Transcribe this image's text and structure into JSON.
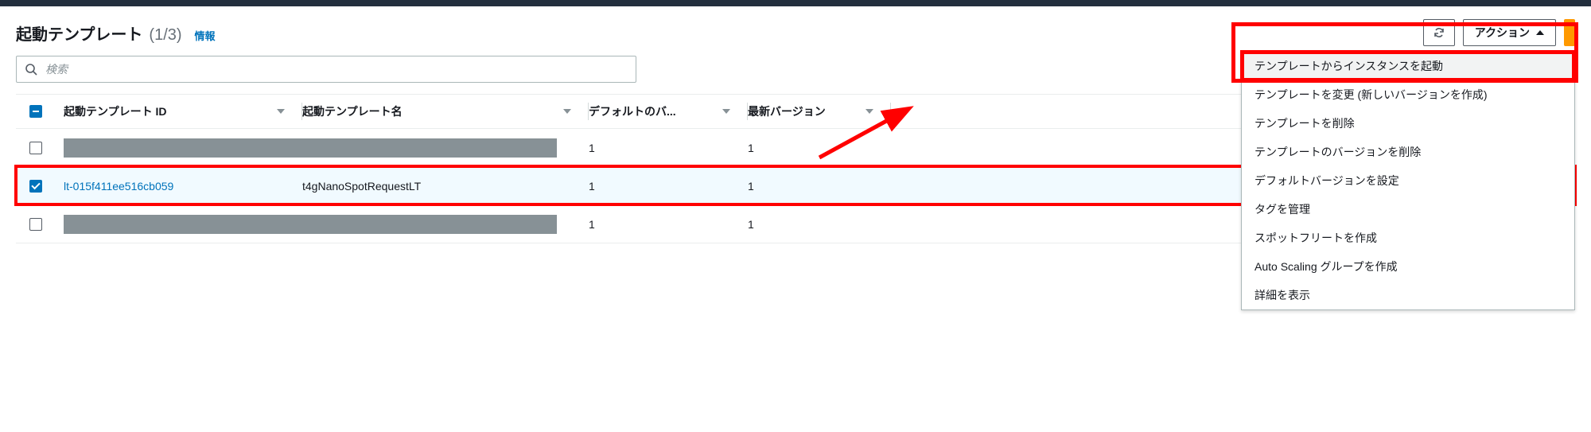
{
  "header": {
    "title": "起動テンプレート",
    "count": "(1/3)",
    "info": "情報"
  },
  "actions": {
    "refresh_aria": "更新",
    "actions_label": "アクション"
  },
  "search": {
    "placeholder": "検索"
  },
  "columns": {
    "id": "起動テンプレート ID",
    "name": "起動テンプレート名",
    "default_version": "デフォルトのバ...",
    "latest_version": "最新バージョン"
  },
  "rows": [
    {
      "id_redacted": true,
      "name_redacted": true,
      "default_version": "1",
      "latest_version": "1",
      "selected": false,
      "trailing": "26"
    },
    {
      "id": "lt-015f411ee516cb059",
      "name": "t4gNanoSpotRequestLT",
      "default_version": "1",
      "latest_version": "1",
      "selected": true,
      "trailing": "26"
    },
    {
      "id_redacted": true,
      "name_redacted": true,
      "default_version": "1",
      "latest_version": "1",
      "selected": false,
      "trailing": "26"
    }
  ],
  "menu": {
    "items": [
      "テンプレートからインスタンスを起動",
      "テンプレートを変更 (新しいバージョンを作成)",
      "テンプレートを削除",
      "テンプレートのバージョンを削除",
      "デフォルトバージョンを設定",
      "タグを管理",
      "スポットフリートを作成",
      "Auto Scaling グループを作成",
      "詳細を表示"
    ]
  }
}
